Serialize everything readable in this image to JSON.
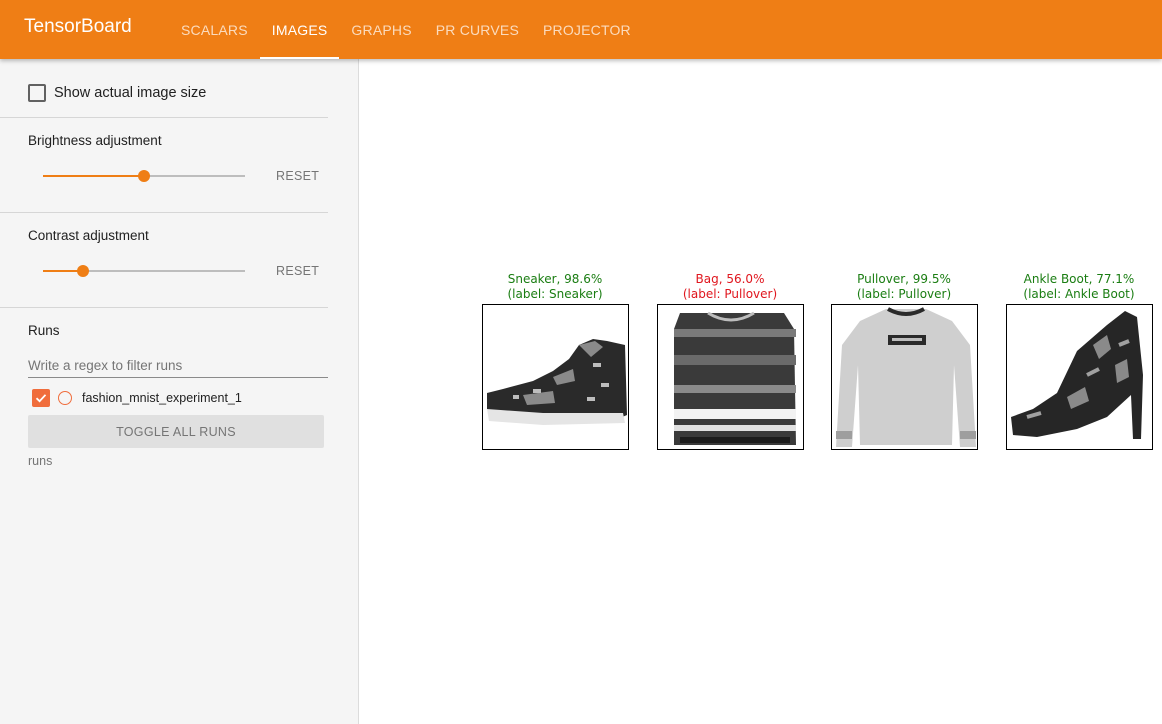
{
  "app": {
    "title": "TensorBoard"
  },
  "tabs": [
    {
      "label": "SCALARS",
      "active": false
    },
    {
      "label": "IMAGES",
      "active": true
    },
    {
      "label": "GRAPHS",
      "active": false
    },
    {
      "label": "PR CURVES",
      "active": false
    },
    {
      "label": "PROJECTOR",
      "active": false
    }
  ],
  "sidebar": {
    "show_actual_size": {
      "label": "Show actual image size",
      "checked": false
    },
    "brightness": {
      "title": "Brightness adjustment",
      "value": 0.5,
      "reset_label": "RESET"
    },
    "contrast": {
      "title": "Contrast adjustment",
      "value": 0.2,
      "reset_label": "RESET"
    },
    "runs": {
      "title": "Runs",
      "filter_placeholder": "Write a regex to filter runs",
      "items": [
        {
          "name": "fashion_mnist_experiment_1",
          "checked": true
        }
      ],
      "toggle_label": "TOGGLE ALL RUNS",
      "footer": "runs"
    }
  },
  "images": [
    {
      "line1": "Sneaker, 98.6%",
      "line2": "(label: Sneaker)",
      "correct": true,
      "icon": "sneaker-image"
    },
    {
      "line1": "Bag, 56.0%",
      "line2": "(label: Pullover)",
      "correct": false,
      "icon": "striped-pullover-image"
    },
    {
      "line1": "Pullover, 99.5%",
      "line2": "(label: Pullover)",
      "correct": true,
      "icon": "pullover-image"
    },
    {
      "line1": "Ankle Boot, 77.1%",
      "line2": "(label: Ankle Boot)",
      "correct": true,
      "icon": "ankle-boot-image"
    }
  ],
  "colors": {
    "accent": "#ef7e15",
    "correct": "#1a7d12",
    "incorrect": "#e0161e",
    "run": "#f06d3c"
  }
}
